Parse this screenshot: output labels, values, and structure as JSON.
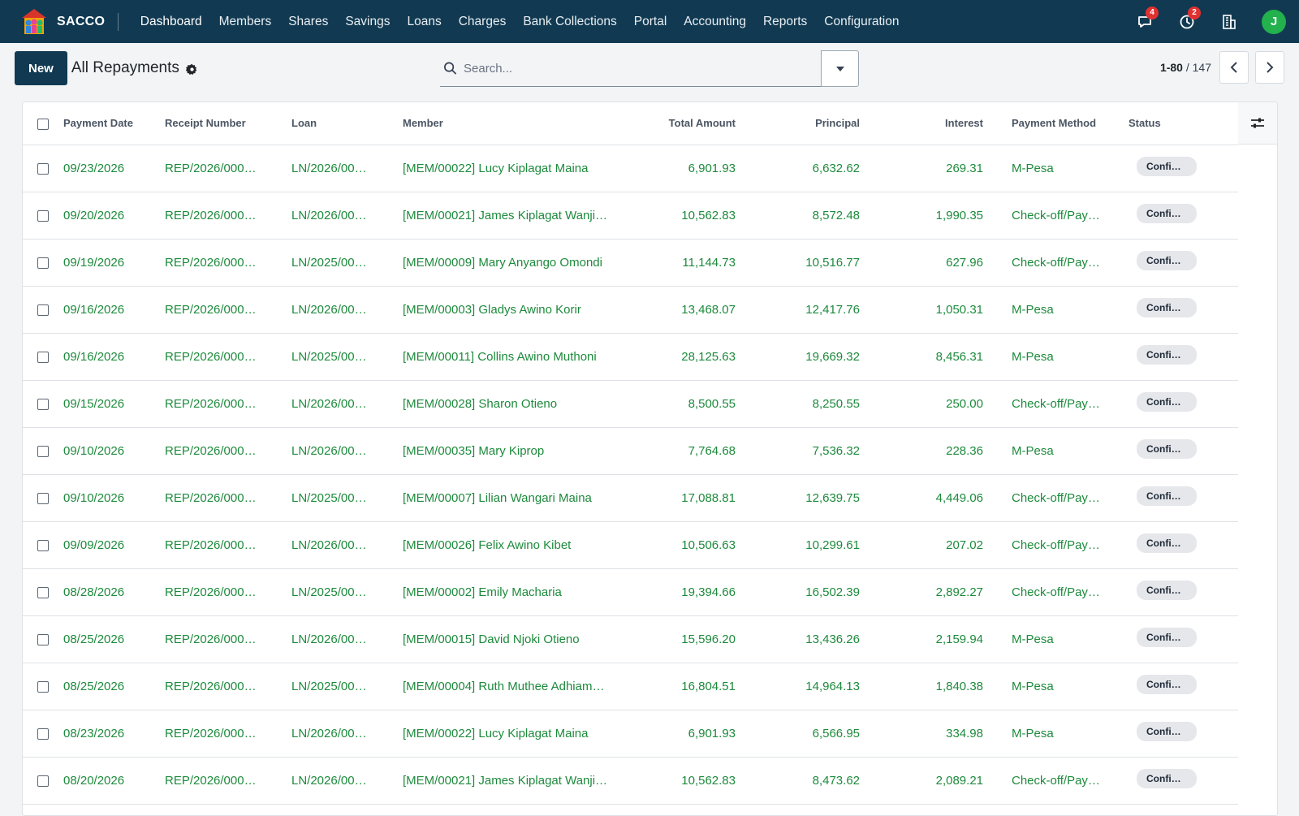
{
  "app": {
    "name": "SACCO"
  },
  "nav": {
    "items": [
      {
        "label": "Dashboard"
      },
      {
        "label": "Members"
      },
      {
        "label": "Shares"
      },
      {
        "label": "Savings"
      },
      {
        "label": "Loans"
      },
      {
        "label": "Charges"
      },
      {
        "label": "Bank Collections"
      },
      {
        "label": "Portal"
      },
      {
        "label": "Accounting"
      },
      {
        "label": "Reports"
      },
      {
        "label": "Configuration"
      }
    ],
    "messages_count": "4",
    "activities_count": "2",
    "user_initial": "J",
    "avatar_color": "#22b14c"
  },
  "control": {
    "new_label": "New",
    "view_title": "All Repayments",
    "search_placeholder": "Search...",
    "pager_range": "1-80",
    "pager_total": "/ 147"
  },
  "table": {
    "headers": {
      "payment_date": "Payment Date",
      "receipt_number": "Receipt Number",
      "loan": "Loan",
      "member": "Member",
      "total_amount": "Total Amount",
      "principal": "Principal",
      "interest": "Interest",
      "payment_method": "Payment Method",
      "status": "Status"
    },
    "rows": [
      {
        "date": "09/23/2026",
        "receipt": "REP/2026/000…",
        "loan": "LN/2026/00…",
        "member": "[MEM/00022] Lucy Kiplagat Maina",
        "total": "6,901.93",
        "principal": "6,632.62",
        "interest": "269.31",
        "method": "M-Pesa",
        "status": "Confi…"
      },
      {
        "date": "09/20/2026",
        "receipt": "REP/2026/000…",
        "loan": "LN/2026/00…",
        "member": "[MEM/00021] James Kiplagat Wanji…",
        "total": "10,562.83",
        "principal": "8,572.48",
        "interest": "1,990.35",
        "method": "Check-off/Pay…",
        "status": "Confi…"
      },
      {
        "date": "09/19/2026",
        "receipt": "REP/2026/000…",
        "loan": "LN/2025/00…",
        "member": "[MEM/00009] Mary Anyango Omondi",
        "total": "11,144.73",
        "principal": "10,516.77",
        "interest": "627.96",
        "method": "Check-off/Pay…",
        "status": "Confi…"
      },
      {
        "date": "09/16/2026",
        "receipt": "REP/2026/000…",
        "loan": "LN/2026/00…",
        "member": "[MEM/00003] Gladys Awino Korir",
        "total": "13,468.07",
        "principal": "12,417.76",
        "interest": "1,050.31",
        "method": "M-Pesa",
        "status": "Confi…"
      },
      {
        "date": "09/16/2026",
        "receipt": "REP/2026/000…",
        "loan": "LN/2025/00…",
        "member": "[MEM/00011] Collins Awino Muthoni",
        "total": "28,125.63",
        "principal": "19,669.32",
        "interest": "8,456.31",
        "method": "M-Pesa",
        "status": "Confi…"
      },
      {
        "date": "09/15/2026",
        "receipt": "REP/2026/000…",
        "loan": "LN/2026/00…",
        "member": "[MEM/00028] Sharon Otieno",
        "total": "8,500.55",
        "principal": "8,250.55",
        "interest": "250.00",
        "method": "Check-off/Pay…",
        "status": "Confi…"
      },
      {
        "date": "09/10/2026",
        "receipt": "REP/2026/000…",
        "loan": "LN/2026/00…",
        "member": "[MEM/00035] Mary Kiprop",
        "total": "7,764.68",
        "principal": "7,536.32",
        "interest": "228.36",
        "method": "M-Pesa",
        "status": "Confi…"
      },
      {
        "date": "09/10/2026",
        "receipt": "REP/2026/000…",
        "loan": "LN/2025/00…",
        "member": "[MEM/00007] Lilian Wangari Maina",
        "total": "17,088.81",
        "principal": "12,639.75",
        "interest": "4,449.06",
        "method": "Check-off/Pay…",
        "status": "Confi…"
      },
      {
        "date": "09/09/2026",
        "receipt": "REP/2026/000…",
        "loan": "LN/2026/00…",
        "member": "[MEM/00026] Felix Awino Kibet",
        "total": "10,506.63",
        "principal": "10,299.61",
        "interest": "207.02",
        "method": "Check-off/Pay…",
        "status": "Confi…"
      },
      {
        "date": "08/28/2026",
        "receipt": "REP/2026/000…",
        "loan": "LN/2025/00…",
        "member": "[MEM/00002] Emily Macharia",
        "total": "19,394.66",
        "principal": "16,502.39",
        "interest": "2,892.27",
        "method": "Check-off/Pay…",
        "status": "Confi…"
      },
      {
        "date": "08/25/2026",
        "receipt": "REP/2026/000…",
        "loan": "LN/2026/00…",
        "member": "[MEM/00015] David Njoki Otieno",
        "total": "15,596.20",
        "principal": "13,436.26",
        "interest": "2,159.94",
        "method": "M-Pesa",
        "status": "Confi…"
      },
      {
        "date": "08/25/2026",
        "receipt": "REP/2026/000…",
        "loan": "LN/2025/00…",
        "member": "[MEM/00004] Ruth Muthee Adhiam…",
        "total": "16,804.51",
        "principal": "14,964.13",
        "interest": "1,840.38",
        "method": "M-Pesa",
        "status": "Confi…"
      },
      {
        "date": "08/23/2026",
        "receipt": "REP/2026/000…",
        "loan": "LN/2026/00…",
        "member": "[MEM/00022] Lucy Kiplagat Maina",
        "total": "6,901.93",
        "principal": "6,566.95",
        "interest": "334.98",
        "method": "M-Pesa",
        "status": "Confi…"
      },
      {
        "date": "08/20/2026",
        "receipt": "REP/2026/000…",
        "loan": "LN/2026/00…",
        "member": "[MEM/00021] James Kiplagat Wanji…",
        "total": "10,562.83",
        "principal": "8,473.62",
        "interest": "2,089.21",
        "method": "Check-off/Pay…",
        "status": "Confi…"
      }
    ]
  },
  "colors": {
    "nav_bg": "#113a52",
    "link_green": "#1d8a3c",
    "badge_red": "#e03131"
  },
  "icons": [
    "logo-icon",
    "chat-icon",
    "clock-icon",
    "building-icon",
    "gear-icon",
    "search-icon",
    "caret-down-icon",
    "chevron-left-icon",
    "chevron-right-icon",
    "column-settings-icon"
  ]
}
